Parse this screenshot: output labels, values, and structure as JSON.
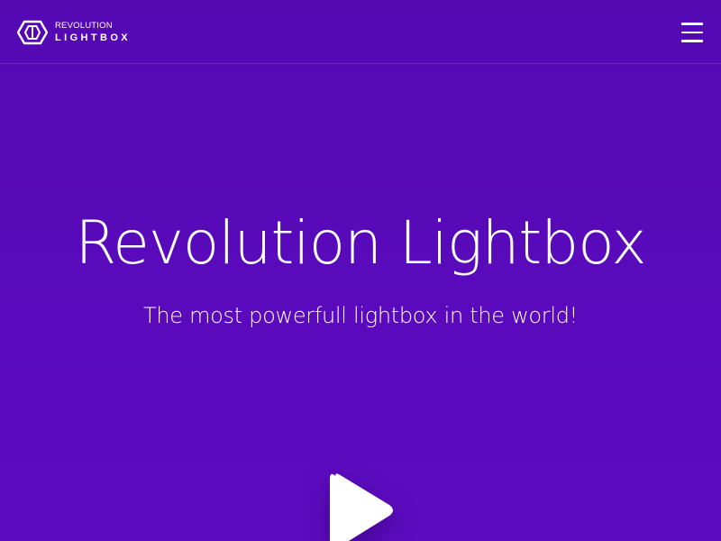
{
  "header": {
    "logo": {
      "icon": "hexagon-logo-icon",
      "top_text": "REVOLUTION",
      "bottom_text": "LIGHTBOX"
    },
    "menu_icon": "hamburger-menu-icon"
  },
  "hero": {
    "title": "Revolution Lightbox",
    "subtitle": "The most powerfull lightbox in the world!",
    "play_icon": "play-icon"
  },
  "colors": {
    "background": "#5409b3",
    "text": "#ffffff"
  }
}
